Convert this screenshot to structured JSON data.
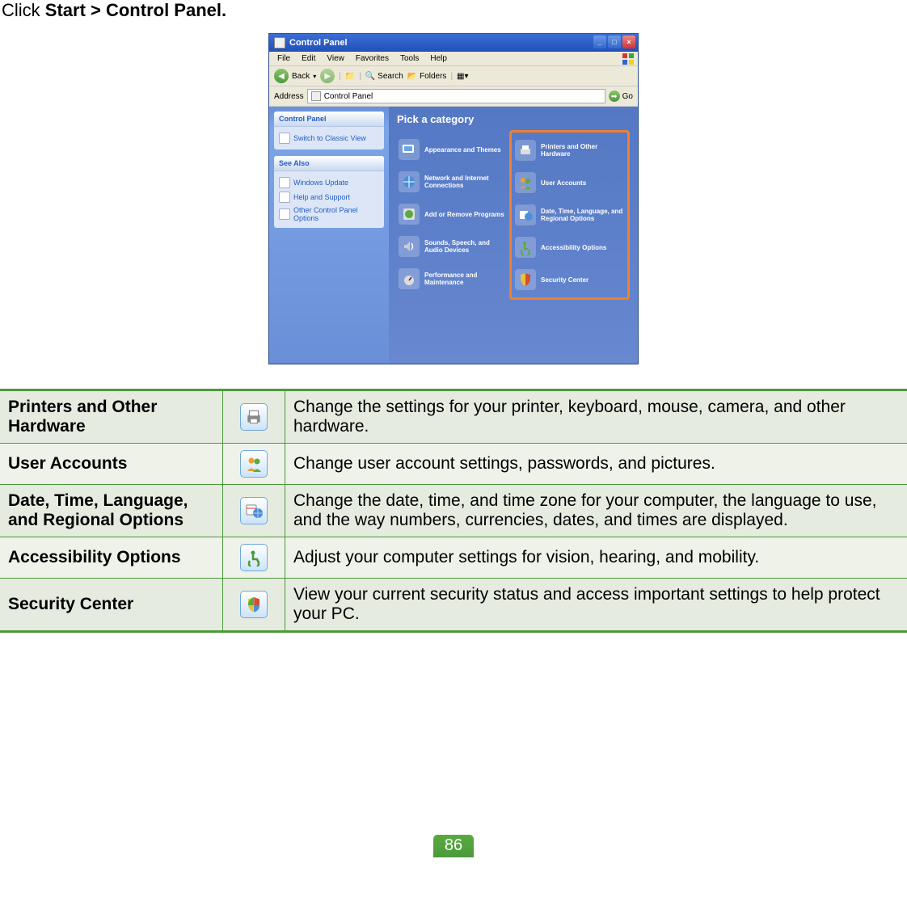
{
  "instruction": {
    "prefix": "Click ",
    "bold": "Start > Control Panel."
  },
  "window": {
    "title": "Control Panel",
    "menu": [
      "File",
      "Edit",
      "View",
      "Favorites",
      "Tools",
      "Help"
    ],
    "toolbar": {
      "back": "Back",
      "search": "Search",
      "folders": "Folders"
    },
    "address": {
      "label": "Address",
      "value": "Control Panel",
      "go": "Go"
    },
    "sidebar": {
      "panel1": {
        "title": "Control Panel",
        "link": "Switch to Classic View"
      },
      "panel2": {
        "title": "See Also",
        "links": [
          "Windows Update",
          "Help and Support",
          "Other Control Panel Options"
        ]
      }
    },
    "main_title": "Pick a category",
    "categories_left": [
      "Appearance and Themes",
      "Network and Internet Connections",
      "Add or Remove Programs",
      "Sounds, Speech, and Audio Devices",
      "Performance and Maintenance"
    ],
    "categories_right": [
      "Printers and Other Hardware",
      "User Accounts",
      "Date, Time, Language, and Regional Options",
      "Accessibility Options",
      "Security Center"
    ]
  },
  "rows": [
    {
      "name": "Printers and Other Hardware",
      "desc": "Change the settings for your printer, keyboard, mouse, camera, and other hardware."
    },
    {
      "name": "User Accounts",
      "desc": "Change user account settings, passwords, and pictures."
    },
    {
      "name": "Date, Time, Language, and Regional Options",
      "desc": "Change the date, time, and time zone for your computer, the language to use, and the way numbers, currencies, dates, and times are displayed."
    },
    {
      "name": "Accessibility Options",
      "desc": "Adjust your computer settings for vision, hearing, and mobility."
    },
    {
      "name": "Security Center",
      "desc": "View your current security status and access important settings to help protect your PC."
    }
  ],
  "page_number": "86"
}
